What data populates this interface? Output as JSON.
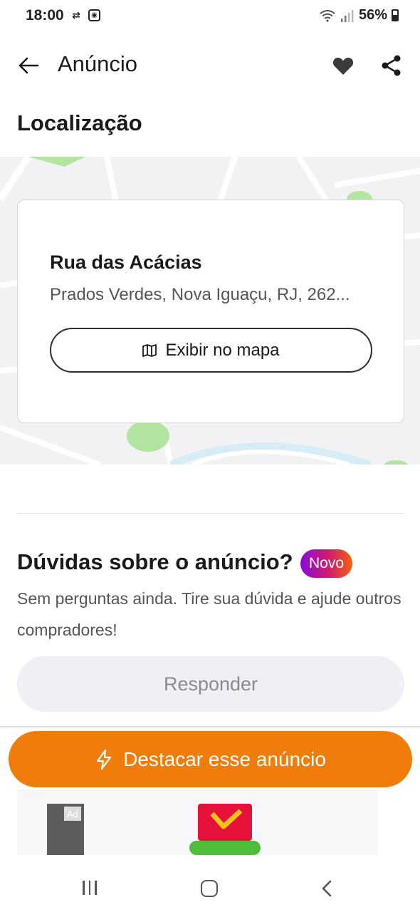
{
  "status_bar": {
    "time": "18:00",
    "battery": "56%"
  },
  "header": {
    "title": "Anúncio"
  },
  "location": {
    "section_title": "Localização",
    "street": "Rua das Acácias",
    "address": "Prados Verdes, Nova Iguaçu, RJ, 262...",
    "map_button_label": "Exibir no mapa"
  },
  "questions": {
    "title": "Dúvidas sobre o anúncio?",
    "badge": "Novo",
    "description": "Sem perguntas ainda. Tire sua dúvida e ajude outros compradores!",
    "reply_label": "Responder"
  },
  "cta": {
    "highlight_label": "Destacar esse anúncio"
  },
  "ad": {
    "badge": "Ad"
  },
  "colors": {
    "accent_orange": "#f07c0a",
    "badge_gradient": [
      "#8a0ad9",
      "#d21c6e",
      "#f2600b"
    ],
    "map_bg": "#f2f2f4",
    "map_green": "#b4e5a0"
  },
  "icons": {
    "back": "arrow-left-icon",
    "favorite": "heart-icon",
    "share": "share-icon",
    "map": "map-icon",
    "highlight": "lightning-icon"
  }
}
